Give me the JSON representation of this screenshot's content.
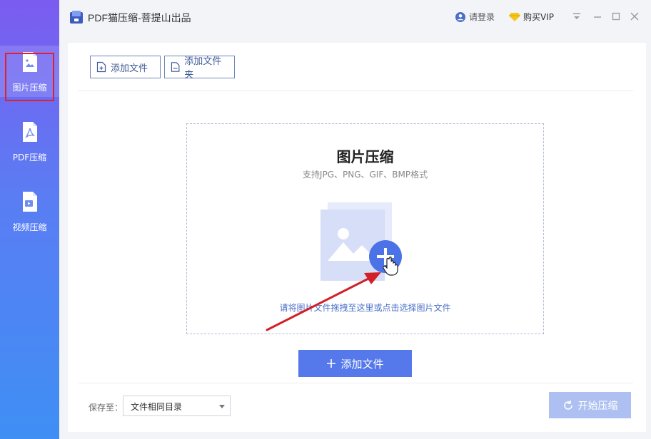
{
  "titlebar": {
    "title": "PDF猫压缩-菩提山出品",
    "login": "请登录",
    "vip": "购买VIP"
  },
  "sidebar": {
    "items": [
      {
        "label": "图片压缩",
        "icon": "image-file-icon"
      },
      {
        "label": "PDF压缩",
        "icon": "pdf-file-icon"
      },
      {
        "label": "视频压缩",
        "icon": "video-file-icon"
      }
    ]
  },
  "toolbar": {
    "add_file": "添加文件",
    "add_folder": "添加文件夹"
  },
  "dropzone": {
    "title": "图片压缩",
    "subtitle": "支持JPG、PNG、GIF、BMP格式",
    "hint": "请将图片文件拖拽至这里或点击选择图片文件"
  },
  "actions": {
    "add_file": "添加文件",
    "save_to_label": "保存至：",
    "save_to_value": "文件相同目录",
    "start": "开始压缩"
  },
  "colors": {
    "accent": "#5578ea",
    "highlight": "#e0202a"
  }
}
